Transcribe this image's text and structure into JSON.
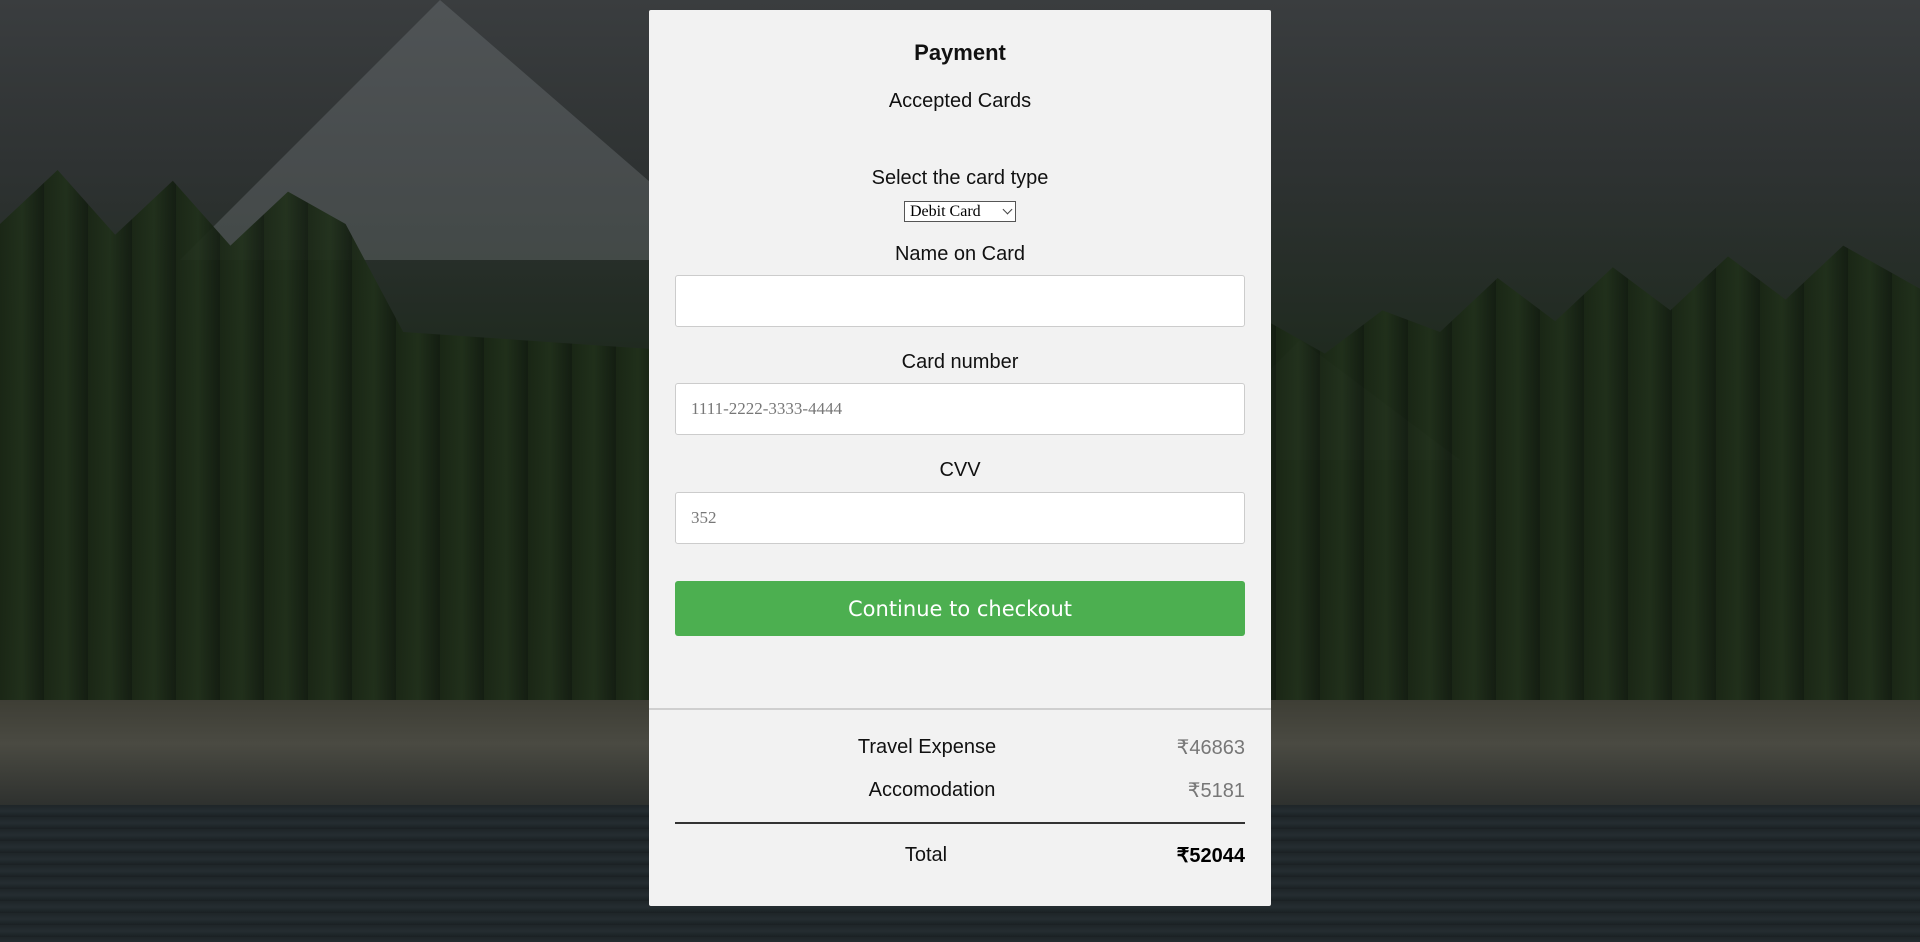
{
  "form": {
    "title": "Payment",
    "accepted_cards_label": "Accepted Cards",
    "card_type_label": "Select the card type",
    "card_type_selected": "Debit Card",
    "name_label": "Name on Card",
    "name_value": "",
    "name_placeholder": "",
    "card_number_label": "Card number",
    "card_number_placeholder": "1111-2222-3333-4444",
    "cvv_label": "CVV",
    "cvv_placeholder": "352",
    "checkout_button": "Continue to checkout"
  },
  "summary": {
    "items": [
      {
        "label": "Travel Expense",
        "amount": "₹46863"
      },
      {
        "label": "Accomodation",
        "amount": "₹5181"
      }
    ],
    "total_label": "Total",
    "total_amount": "₹52044"
  },
  "colors": {
    "button": "#4caf50",
    "card_bg": "#f2f2f2"
  },
  "icons": {
    "select_arrow": "chevron-down-icon"
  }
}
